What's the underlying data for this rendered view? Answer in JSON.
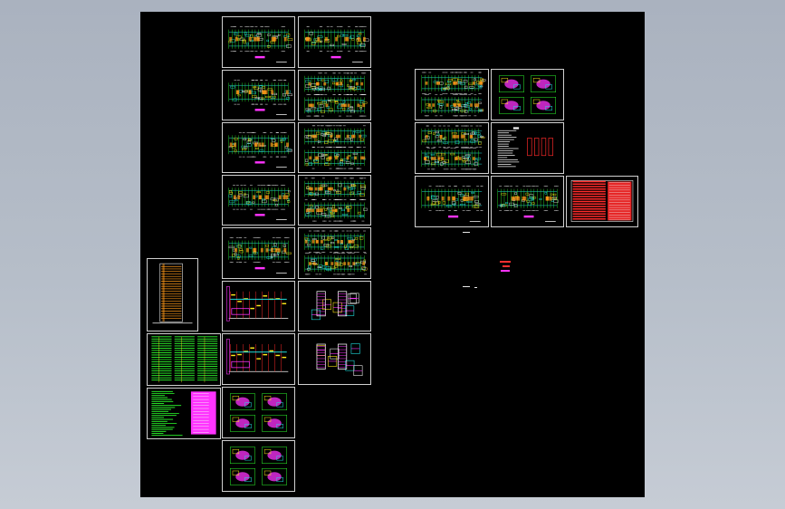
{
  "viewport": {
    "background": "#000000",
    "frame_color": "#d0d0d0",
    "outer_background": "#b4bcc7"
  },
  "palette": {
    "green": "#2dff2d",
    "cyan": "#21e6e6",
    "yellow": "#ffe81a",
    "magenta": "#ff33ff",
    "red": "#ff2a2a",
    "white": "#f2f2f2",
    "orange": "#ff9a1a"
  },
  "sheets": [
    {
      "id": "col1-elevation",
      "style": "elevation"
    },
    {
      "id": "col1-table-green",
      "style": "table"
    },
    {
      "id": "col1-notes",
      "style": "notes"
    },
    {
      "id": "col2-plan-1",
      "style": "plan-single"
    },
    {
      "id": "col2-plan-2",
      "style": "plan-single"
    },
    {
      "id": "col2-plan-3",
      "style": "plan-single"
    },
    {
      "id": "col2-plan-4",
      "style": "plan-single"
    },
    {
      "id": "col2-plan-5",
      "style": "plan-single"
    },
    {
      "id": "col2-section-1",
      "style": "section"
    },
    {
      "id": "col2-section-2",
      "style": "section"
    },
    {
      "id": "col2-units-1",
      "style": "units"
    },
    {
      "id": "col2-units-2",
      "style": "units"
    },
    {
      "id": "col3-plan-1",
      "style": "plan-single"
    },
    {
      "id": "col3-plan-double-1",
      "style": "plan-double"
    },
    {
      "id": "col3-plan-double-2",
      "style": "plan-double"
    },
    {
      "id": "col3-plan-double-3",
      "style": "plan-double"
    },
    {
      "id": "col3-plan-double-4",
      "style": "plan-double"
    },
    {
      "id": "col3-details-1",
      "style": "details"
    },
    {
      "id": "col3-details-2",
      "style": "details"
    },
    {
      "id": "right-plan-double-1",
      "style": "plan-double"
    },
    {
      "id": "right-units",
      "style": "units"
    },
    {
      "id": "right-plan-double-2",
      "style": "plan-double"
    },
    {
      "id": "right-notes",
      "style": "notes-white"
    },
    {
      "id": "right-plan-1",
      "style": "plan-single"
    },
    {
      "id": "right-plan-2",
      "style": "plan-single"
    },
    {
      "id": "right-table-red",
      "style": "red-table"
    }
  ]
}
